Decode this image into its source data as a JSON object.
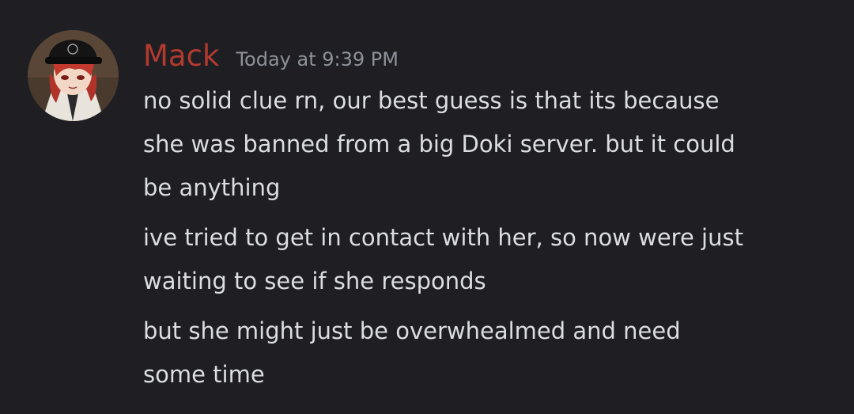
{
  "message": {
    "author": {
      "name": "Mack",
      "name_color": "#b23a2f",
      "avatar_icon": "avatar-anime-character-icon"
    },
    "timestamp": "Today at 9:39 PM",
    "lines": [
      "no solid clue rn, our best guess is that its because\nshe was banned from a big Doki server. but it could\nbe anything",
      "ive tried to get in contact with her, so now were just\nwaiting to see if she responds",
      "but she might just be overwhealmed and need\nsome time"
    ]
  }
}
